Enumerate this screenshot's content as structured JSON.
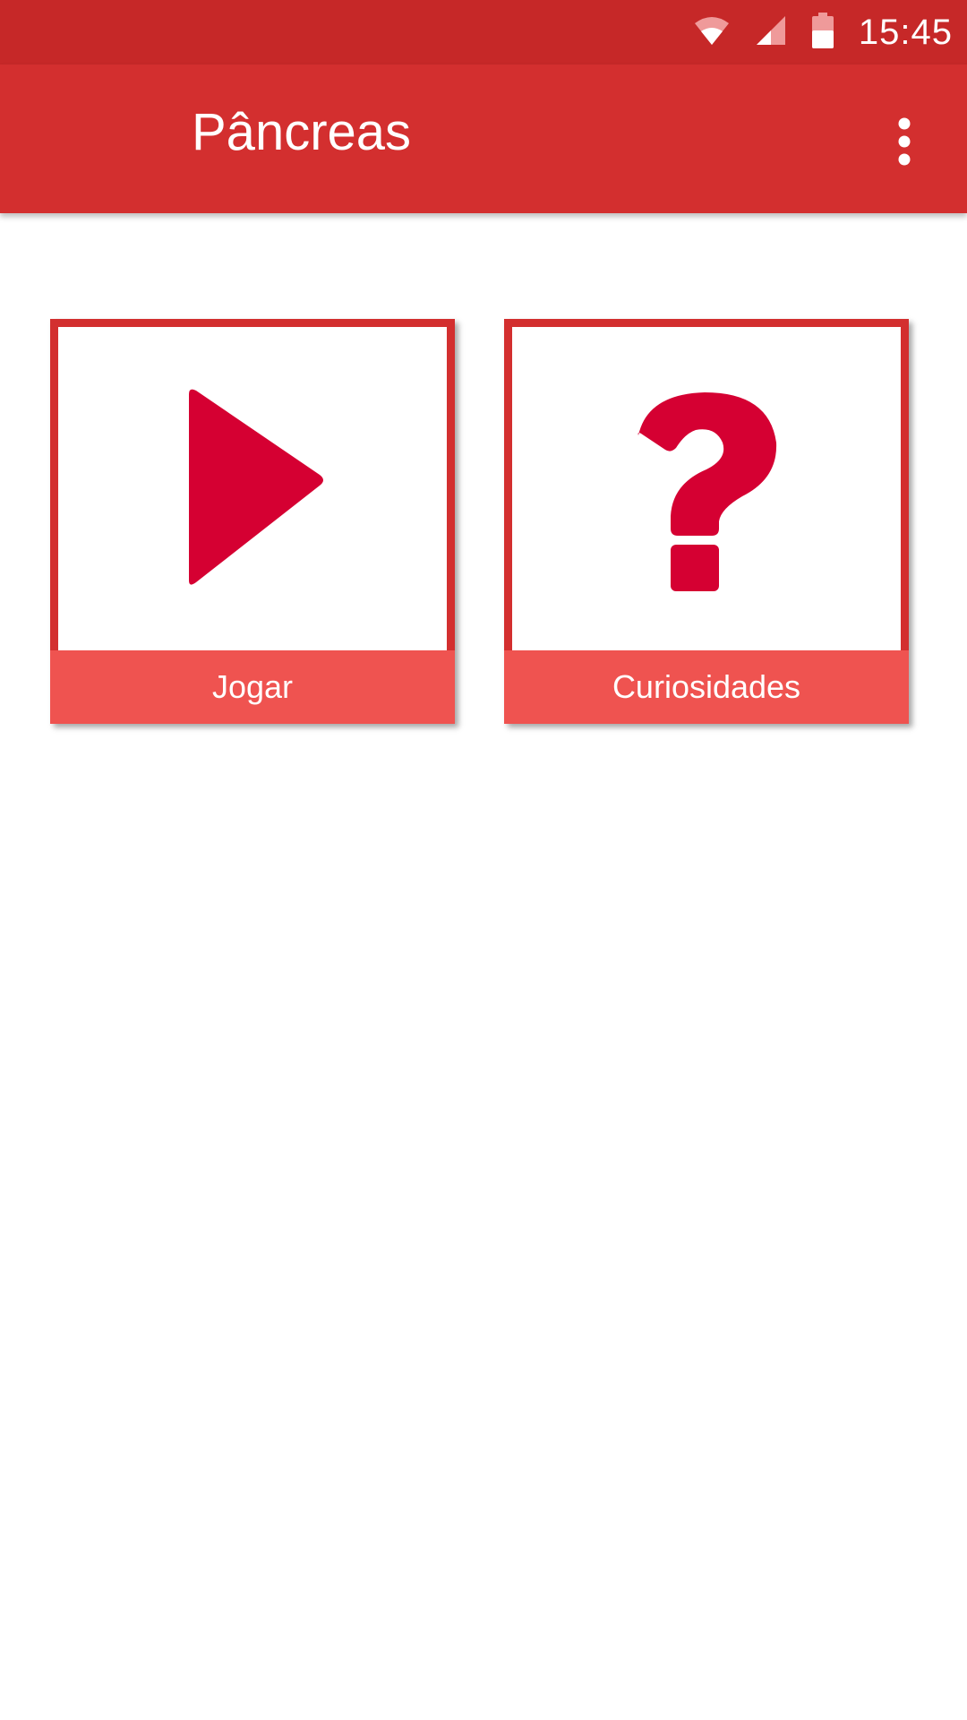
{
  "status_bar": {
    "time": "15:45",
    "icons": [
      "wifi-icon",
      "cell-signal-icon",
      "battery-icon"
    ]
  },
  "app_bar": {
    "title": "Pâncreas",
    "overflow_icon": "more-vert-icon"
  },
  "tiles": [
    {
      "label": "Jogar",
      "icon": "play-icon"
    },
    {
      "label": "Curiosidades",
      "icon": "question-mark-icon"
    }
  ],
  "colors": {
    "status_bar": "#c62828",
    "app_bar": "#d32f2f",
    "tile_label_bg": "#ef5350",
    "icon_red": "#d50032"
  }
}
